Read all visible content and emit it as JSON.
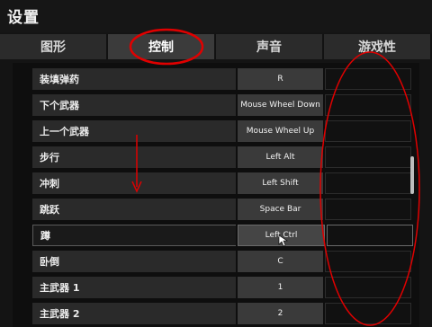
{
  "window": {
    "title": "设置"
  },
  "tabs": [
    {
      "label": "图形"
    },
    {
      "label": "控制"
    },
    {
      "label": "声音"
    },
    {
      "label": "游戏性"
    }
  ],
  "bindings": [
    {
      "action": "装填弹药",
      "key": "R"
    },
    {
      "action": "下个武器",
      "key": "Mouse Wheel Down"
    },
    {
      "action": "上一个武器",
      "key": "Mouse Wheel Up"
    },
    {
      "action": "步行",
      "key": "Left Alt"
    },
    {
      "action": "冲刺",
      "key": "Left Shift"
    },
    {
      "action": "跳跃",
      "key": "Space Bar"
    },
    {
      "action": "蹲",
      "key": "Left Ctrl"
    },
    {
      "action": "卧倒",
      "key": "C"
    },
    {
      "action": "主武器 1",
      "key": "1"
    },
    {
      "action": "主武器 2",
      "key": "2"
    }
  ],
  "colors": {
    "annotation": "#e00000",
    "background": "#141414",
    "panel": "#2a2a2a"
  }
}
